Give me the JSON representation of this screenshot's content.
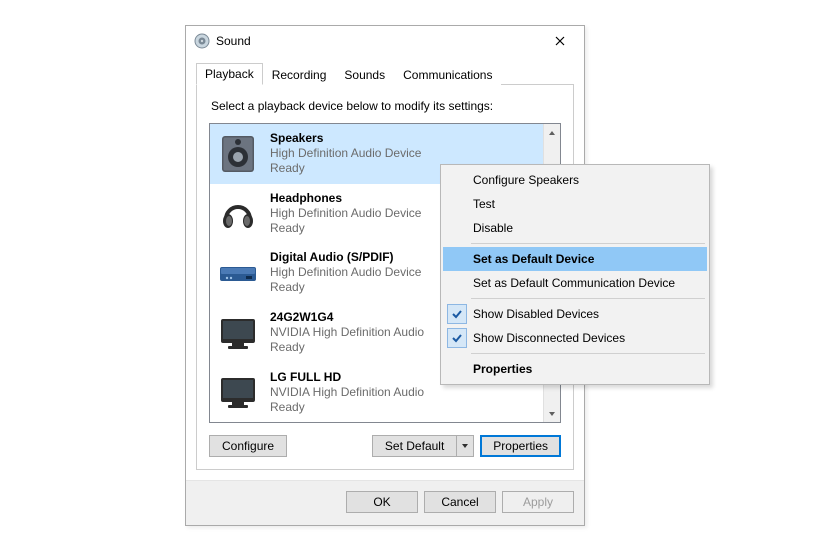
{
  "window": {
    "title": "Sound"
  },
  "tabs": [
    {
      "label": "Playback"
    },
    {
      "label": "Recording"
    },
    {
      "label": "Sounds"
    },
    {
      "label": "Communications"
    }
  ],
  "instruction": "Select a playback device below to modify its settings:",
  "devices": [
    {
      "name": "Speakers",
      "sub": "High Definition Audio Device",
      "status": "Ready"
    },
    {
      "name": "Headphones",
      "sub": "High Definition Audio Device",
      "status": "Ready"
    },
    {
      "name": "Digital Audio (S/PDIF)",
      "sub": "High Definition Audio Device",
      "status": "Ready"
    },
    {
      "name": "24G2W1G4",
      "sub": "NVIDIA High Definition Audio",
      "status": "Ready"
    },
    {
      "name": "LG FULL HD",
      "sub": "NVIDIA High Definition Audio",
      "status": "Ready"
    }
  ],
  "buttons": {
    "configure": "Configure",
    "setdefault": "Set Default",
    "properties": "Properties",
    "ok": "OK",
    "cancel": "Cancel",
    "apply": "Apply"
  },
  "context_menu": {
    "items": [
      "Configure Speakers",
      "Test",
      "Disable",
      "Set as Default Device",
      "Set as Default Communication Device",
      "Show Disabled Devices",
      "Show Disconnected Devices",
      "Properties"
    ]
  }
}
